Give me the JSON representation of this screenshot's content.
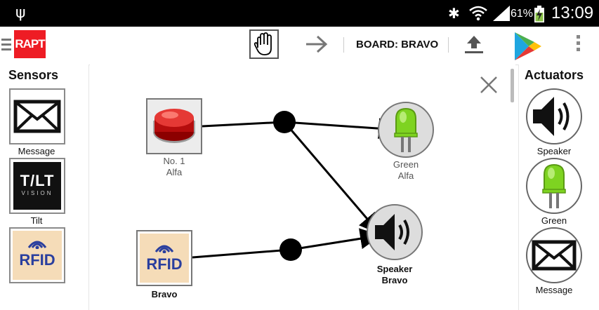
{
  "status_bar": {
    "usb_glyph": "ψ",
    "bluetooth_glyph": "✱",
    "battery_percent": "61%",
    "time": "13:09"
  },
  "app_bar": {
    "logo_text": "RAPT",
    "board_label": "BOARD: BRAVO"
  },
  "sensors": {
    "title": "Sensors",
    "items": [
      {
        "label": "Message",
        "icon": "envelope-icon"
      },
      {
        "label": "Tilt",
        "icon": "tilt-icon",
        "line1": "T/LT",
        "line2": "VISION"
      },
      {
        "label": "",
        "icon": "rfid-icon",
        "text": "RFID"
      }
    ]
  },
  "actuators": {
    "title": "Actuators",
    "items": [
      {
        "label": "Speaker",
        "icon": "speaker-icon"
      },
      {
        "label": "Green",
        "icon": "green-led-icon"
      },
      {
        "label": "Message",
        "icon": "envelope-icon"
      }
    ]
  },
  "canvas": {
    "nodes": [
      {
        "id": "button-no1",
        "line1": "No. 1",
        "line2": "Alfa",
        "icon": "red-button-icon"
      },
      {
        "id": "green-alfa",
        "line1": "Green",
        "line2": "Alfa",
        "icon": "green-led-icon"
      },
      {
        "id": "rfid-bravo",
        "line1": "Bravo",
        "line2": "",
        "icon": "rfid-icon",
        "text": "RFID"
      },
      {
        "id": "speaker-bravo",
        "line1": "Speaker",
        "line2": "Bravo",
        "icon": "speaker-icon"
      }
    ],
    "connections": [
      {
        "from": "button-no1",
        "to": "green-alfa"
      },
      {
        "from": "button-no1",
        "to": "speaker-bravo"
      },
      {
        "from": "rfid-bravo",
        "to": "speaker-bravo"
      }
    ]
  },
  "colors": {
    "logo_red": "#ee1c24",
    "led_green": "#7ed321",
    "battery_green": "#8bc34a"
  }
}
